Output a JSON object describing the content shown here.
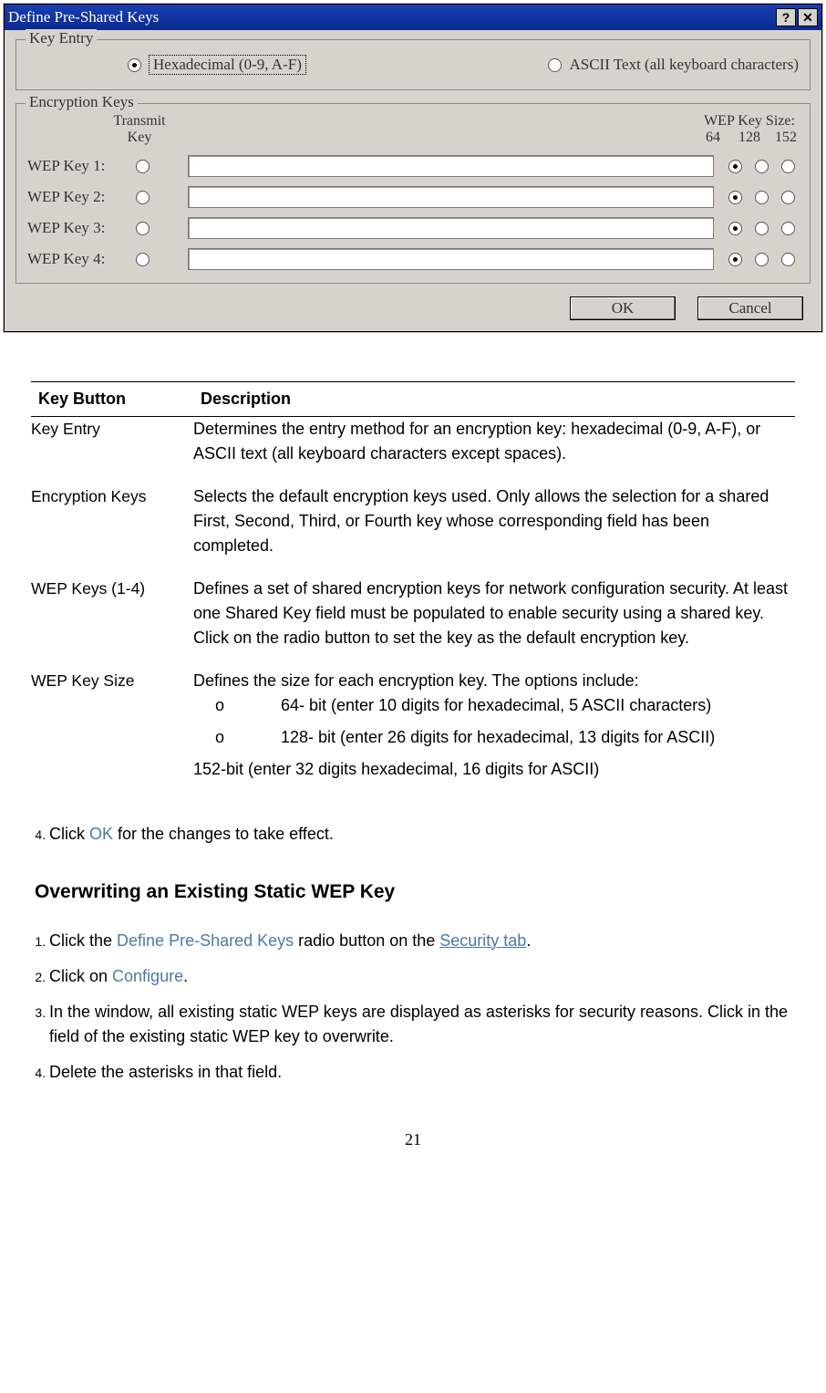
{
  "dialog": {
    "title": "Define Pre-Shared Keys",
    "help_glyph": "?",
    "close_glyph": "✕",
    "key_entry": {
      "legend": "Key Entry",
      "hex_label": "Hexadecimal (0-9, A-F)",
      "ascii_label": "ASCII Text (all keyboard characters)"
    },
    "encryption": {
      "legend": "Encryption Keys",
      "transmit_label_1": "Transmit",
      "transmit_label_2": "Key",
      "size_label": "WEP Key Size:",
      "size_64": "64",
      "size_128": "128",
      "size_152": "152",
      "rows": [
        {
          "label": "WEP Key 1:"
        },
        {
          "label": "WEP Key 2:"
        },
        {
          "label": "WEP Key 3:"
        },
        {
          "label": "WEP Key 4:"
        }
      ]
    },
    "ok": "OK",
    "cancel": "Cancel"
  },
  "table": {
    "header_key": "Key Button",
    "header_desc": "Description",
    "rows": [
      {
        "k": "Key Entry",
        "d": "Determines the entry method for an encryption key: hexadecimal (0-9, A-F), or ASCII text (all keyboard characters except spaces)."
      },
      {
        "k": "Encryption Keys",
        "d": "Selects the default encryption keys used. Only allows the selection for a shared First, Second, Third, or Fourth key whose corresponding field has been completed."
      },
      {
        "k": "WEP Keys (1-4)",
        "d1": "Defines a set of shared encryption keys for network configuration security. At least one Shared Key field must be populated to enable security using a shared key.",
        "d2": "Click on the radio button to set the key as the default encryption key."
      },
      {
        "k": "WEP Key Size",
        "d": "Defines the size for each encryption key. The options include:",
        "b1": "64- bit (enter 10 digits for hexadecimal, 5 ASCII characters)",
        "b2": "128- bit (enter 26 digits for hexadecimal, 13 digits for ASCII)",
        "b3": "152-bit (enter 32 digits hexadecimal, 16 digits for ASCII)"
      }
    ]
  },
  "step4": {
    "pre": "Click ",
    "ok": "OK",
    "post": " for the changes to take effect."
  },
  "section_title": "Overwriting an Existing Static WEP Key",
  "ow_steps": {
    "s1a": "Click the ",
    "s1b": "Define Pre-Shared Keys",
    "s1c": " radio button on the ",
    "s1d": "Security tab",
    "s1e": ".",
    "s2a": "Click on ",
    "s2b": "Configure",
    "s2c": ".",
    "s3": "In the window, all existing static WEP keys are displayed as asterisks for security reasons. Click in the field of the  existing static WEP key to overwrite.",
    "s4": "Delete the asterisks in that field."
  },
  "o_marker": "o",
  "page_number": "21"
}
